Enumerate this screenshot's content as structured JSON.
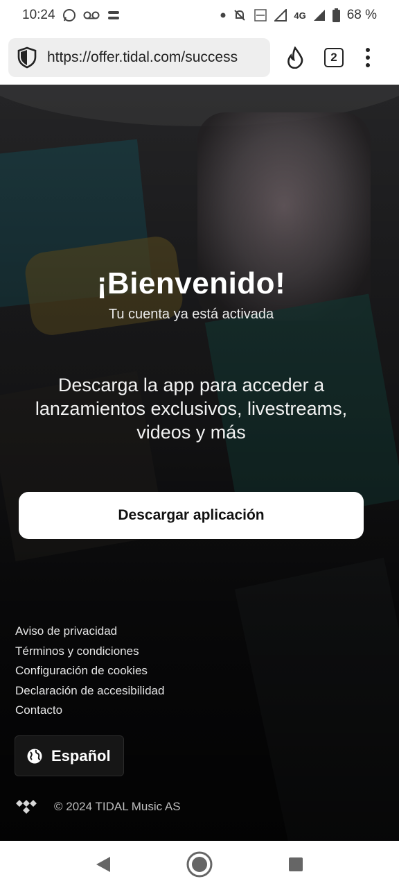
{
  "status_bar": {
    "time": "10:24",
    "battery": "68 %",
    "network": "4G"
  },
  "browser": {
    "url": "https://offer.tidal.com/success",
    "tab_count": "2"
  },
  "page": {
    "title": "¡Bienvenido!",
    "subtitle": "Tu cuenta ya está activada",
    "promo_line1": "Descarga la app para acceder a",
    "promo_line2": "lanzamientos exclusivos, livestreams,",
    "promo_line3": "videos y más",
    "download_label": "Descargar aplicación"
  },
  "footer": {
    "links": [
      "Aviso de privacidad",
      "Términos y condiciones",
      "Configuración de cookies",
      "Declaración de accesibilidad",
      "Contacto"
    ],
    "language": "Español",
    "copyright": "© 2024 TIDAL Music AS"
  },
  "icons": {
    "shield": "shield-icon",
    "fire": "fire-icon",
    "globe": "globe-icon",
    "tidal_logo": "tidal-logo-icon"
  }
}
